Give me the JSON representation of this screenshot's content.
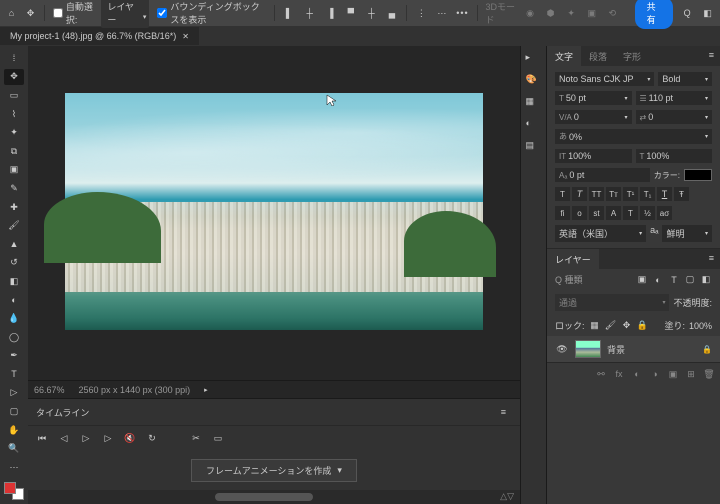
{
  "menubar": {
    "auto_select_label": "自動選択:",
    "auto_select_value": "レイヤー",
    "show_bbox_label": "バウンディングボックスを表示",
    "mode3d_label": "3Dモード",
    "share_label": "共有"
  },
  "tab": {
    "title": "My project-1 (48).jpg @ 66.7% (RGB/16*)"
  },
  "status": {
    "zoom": "66.67%",
    "doc": "2560 px x 1440 px (300 ppi)"
  },
  "timeline": {
    "title": "タイムライン",
    "create_frame_anim": "フレームアニメーションを作成"
  },
  "char": {
    "tab_char": "文字",
    "tab_para": "段落",
    "tab_glyph": "字形",
    "font_family": "Noto Sans CJK JP",
    "font_style": "Bold",
    "size": "50 pt",
    "leading": "110 pt",
    "kerning": "0",
    "tracking": "0",
    "vscale": "0%",
    "hscale": "100%",
    "tsume": "100%",
    "baseline": "0 pt",
    "color_label": "カラー:",
    "lang": "英語（米国）",
    "aa": "鮮明"
  },
  "layers": {
    "tab": "レイヤー",
    "blend": "通過",
    "opacity_label": "不透明度:",
    "lock_label": "ロック:",
    "fill_label": "塗り:",
    "fill_value": "100%",
    "layer_name": "背景"
  }
}
